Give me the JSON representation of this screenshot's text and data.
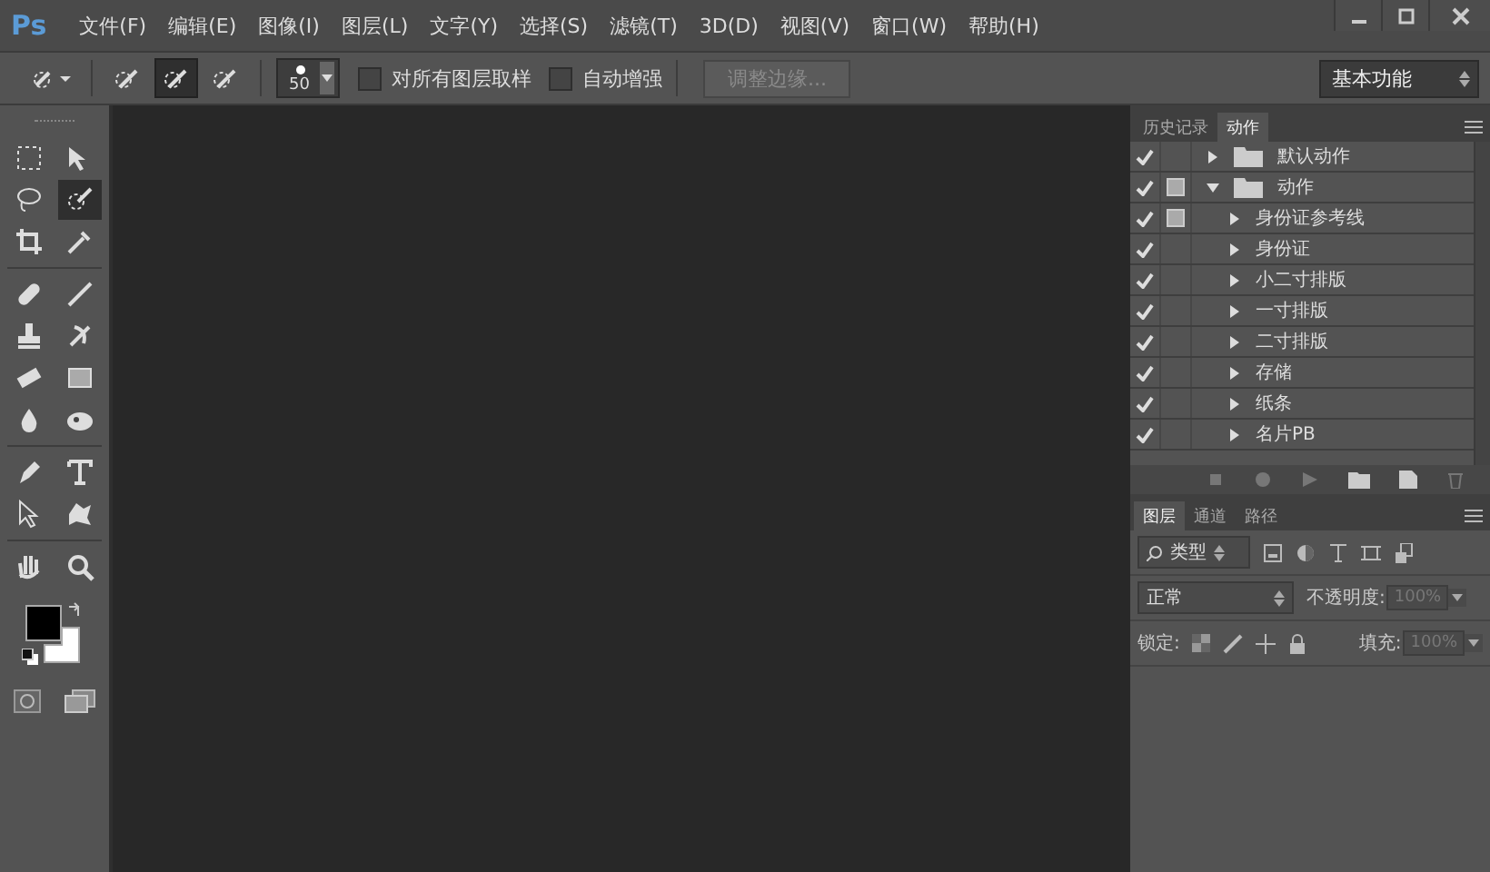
{
  "app": {
    "logo": "Ps"
  },
  "menu": [
    "文件(F)",
    "编辑(E)",
    "图像(I)",
    "图层(L)",
    "文字(Y)",
    "选择(S)",
    "滤镜(T)",
    "3D(D)",
    "视图(V)",
    "窗口(W)",
    "帮助(H)"
  ],
  "options": {
    "modes": [
      {
        "selected": false
      },
      {
        "selected": true
      },
      {
        "selected": false
      }
    ],
    "brush_size": "50",
    "checkboxes": [
      {
        "label": "对所有图层取样",
        "checked": false
      },
      {
        "label": "自动增强",
        "checked": false
      }
    ],
    "refine_button": {
      "label": "调整边缘...",
      "disabled": true
    },
    "workspace": "基本功能"
  },
  "tools": [
    {
      "selected": false
    },
    {
      "selected": false
    },
    {
      "selected": false
    },
    {
      "selected": true
    },
    {
      "selected": false
    },
    {
      "selected": false
    },
    {
      "selected": false
    },
    {
      "selected": false
    },
    {
      "selected": false
    },
    {
      "selected": false
    },
    {
      "selected": false
    },
    {
      "selected": false
    },
    {
      "selected": false
    },
    {
      "selected": false
    },
    {
      "selected": false
    },
    {
      "selected": false
    },
    {
      "selected": false
    },
    {
      "selected": false
    },
    {
      "selected": false
    },
    {
      "selected": false
    }
  ],
  "actions_panel": {
    "tabs": [
      {
        "label": "历史记录",
        "selected": false
      },
      {
        "label": "动作",
        "selected": true
      }
    ],
    "sets": [
      {
        "name": "默认动作",
        "checked": true,
        "dialog": false,
        "expanded": false
      },
      {
        "name": "动作",
        "checked": true,
        "dialog": true,
        "expanded": true,
        "children": [
          {
            "name": "身份证参考线",
            "checked": true,
            "dialog": true
          },
          {
            "name": "身份证",
            "checked": true,
            "dialog": false
          },
          {
            "name": "小二寸排版",
            "checked": true,
            "dialog": false
          },
          {
            "name": "一寸排版",
            "checked": true,
            "dialog": false
          },
          {
            "name": "二寸排版",
            "checked": true,
            "dialog": false
          },
          {
            "name": "存储",
            "checked": true,
            "dialog": false
          },
          {
            "name": "纸条",
            "checked": true,
            "dialog": false
          },
          {
            "name": "名片PB",
            "checked": true,
            "dialog": false
          }
        ]
      }
    ]
  },
  "layers_panel": {
    "tabs": [
      {
        "label": "图层",
        "selected": true
      },
      {
        "label": "通道",
        "selected": false
      },
      {
        "label": "路径",
        "selected": false
      }
    ],
    "filter": "类型",
    "blend_mode": "正常",
    "opacity_label": "不透明度:",
    "opacity": "100%",
    "lock_label": "锁定:",
    "fill_label": "填充:",
    "fill": "100%"
  }
}
